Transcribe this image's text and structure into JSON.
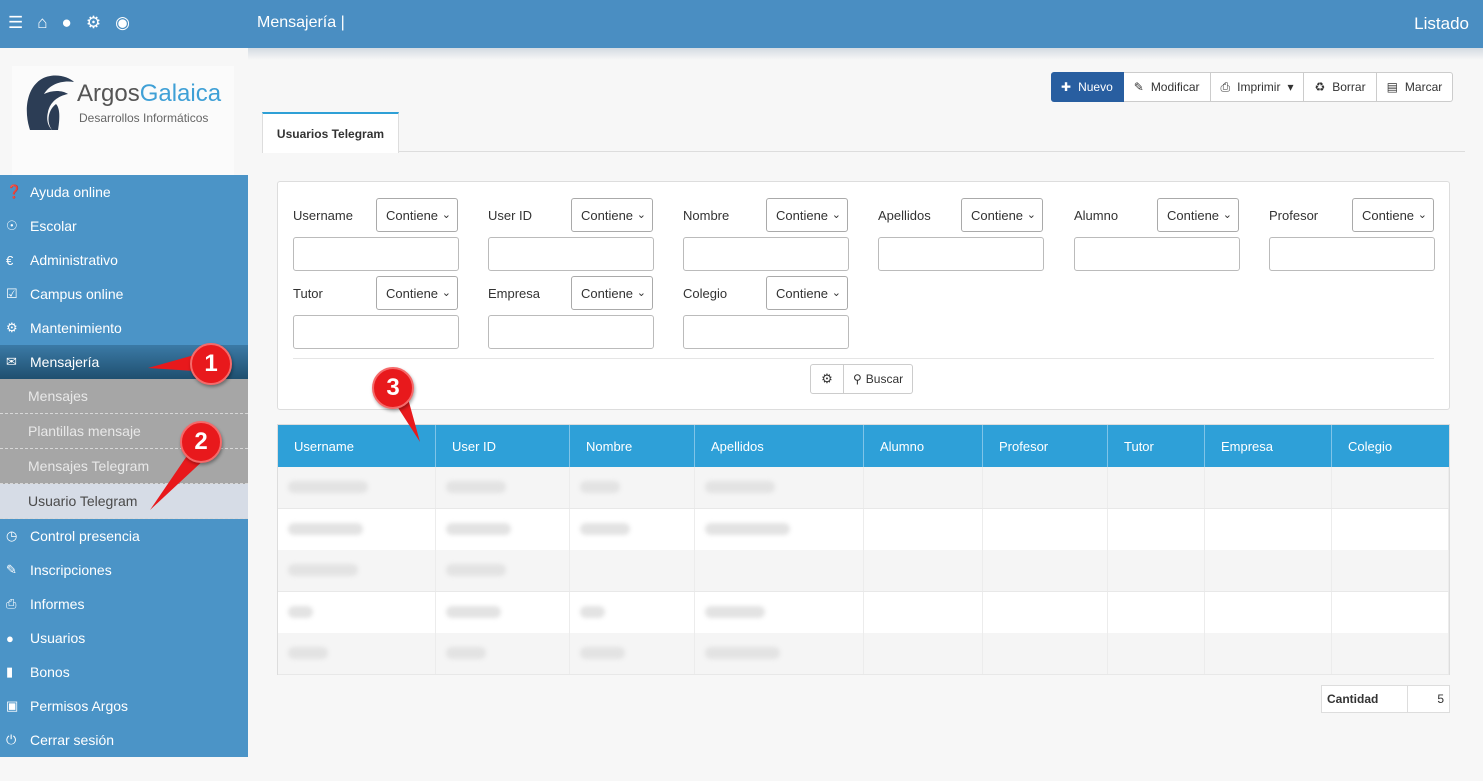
{
  "topbar": {
    "title": "Mensajería |",
    "right": "Listado"
  },
  "logo": {
    "brand_a": "Argos",
    "brand_b": "Galaica",
    "tagline": "Desarrollos Informáticos"
  },
  "menu": [
    {
      "label": "Ayuda online",
      "icon": "question-icon"
    },
    {
      "label": "Escolar",
      "icon": "compass-icon"
    },
    {
      "label": "Administrativo",
      "icon": "euro-icon"
    },
    {
      "label": "Campus online",
      "icon": "check-square-icon"
    },
    {
      "label": "Mantenimiento",
      "icon": "gear-icon"
    },
    {
      "label": "Mensajería",
      "icon": "envelope-icon"
    }
  ],
  "submenu": [
    "Mensajes",
    "Plantillas mensaje",
    "Mensajes Telegram",
    "Usuario Telegram"
  ],
  "menu2": [
    {
      "label": "Control presencia",
      "icon": "clock-icon"
    },
    {
      "label": "Inscripciones",
      "icon": "pencil-icon"
    },
    {
      "label": "Informes",
      "icon": "print-icon"
    },
    {
      "label": "Usuarios",
      "icon": "user-icon"
    },
    {
      "label": "Bonos",
      "icon": "barcode-icon"
    },
    {
      "label": "Permisos Argos",
      "icon": "lock-icon"
    },
    {
      "label": "Cerrar sesión",
      "icon": "power-icon"
    }
  ],
  "toolbar": {
    "nuevo": "Nuevo",
    "modificar": "Modificar",
    "imprimir": "Imprimir",
    "borrar": "Borrar",
    "marcar": "Marcar"
  },
  "tab": "Usuarios Telegram",
  "filters": [
    {
      "label": "Username",
      "op": "Contiene"
    },
    {
      "label": "User ID",
      "op": "Contiene"
    },
    {
      "label": "Nombre",
      "op": "Contiene"
    },
    {
      "label": "Apellidos",
      "op": "Contiene"
    },
    {
      "label": "Alumno",
      "op": "Contiene"
    },
    {
      "label": "Profesor",
      "op": "Contiene"
    },
    {
      "label": "Tutor",
      "op": "Contiene"
    },
    {
      "label": "Empresa",
      "op": "Contiene"
    },
    {
      "label": "Colegio",
      "op": "Contiene"
    }
  ],
  "search_label": "Buscar",
  "columns": [
    "Username",
    "User ID",
    "Nombre",
    "Apellidos",
    "Alumno",
    "Profesor",
    "Tutor",
    "Empresa",
    "Colegio"
  ],
  "totals": {
    "label": "Cantidad",
    "value": "5"
  },
  "annotations": [
    "1",
    "2",
    "3"
  ]
}
